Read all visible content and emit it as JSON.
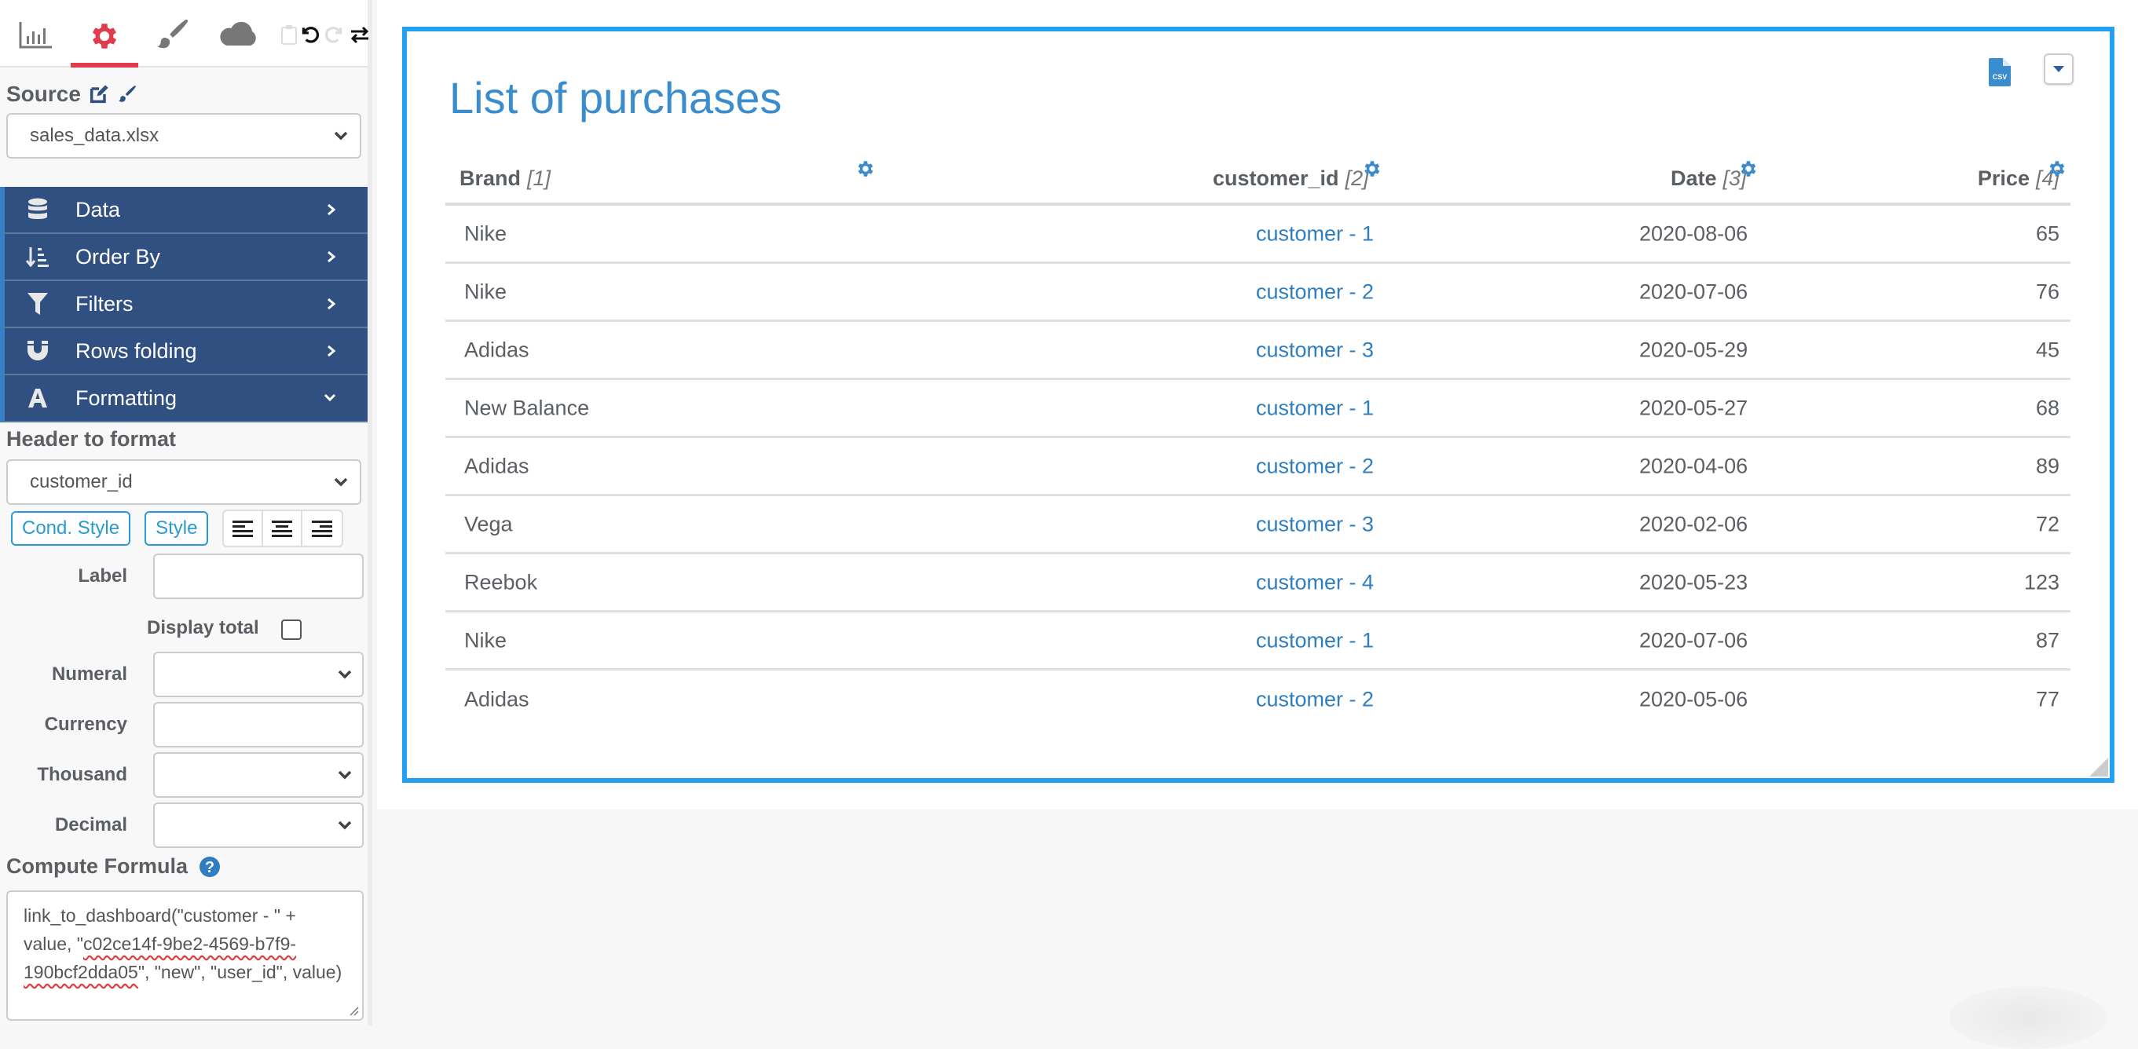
{
  "toolbar": {
    "tabs": [
      {
        "icon": "bar-chart-icon",
        "active": false
      },
      {
        "icon": "gear-icon",
        "active": true
      },
      {
        "icon": "paintbrush-icon",
        "active": false
      },
      {
        "icon": "cloud-icon",
        "active": false
      }
    ],
    "actions": [
      "clipboard-icon",
      "undo-icon",
      "redo-icon",
      "swap-icon"
    ],
    "active_color": "#e23b4d"
  },
  "source": {
    "label": "Source",
    "selected": "sales_data.xlsx"
  },
  "accordion": [
    {
      "label": "Data",
      "icon": "database-icon",
      "expanded": false
    },
    {
      "label": "Order By",
      "icon": "sort-icon",
      "expanded": false
    },
    {
      "label": "Filters",
      "icon": "filter-icon",
      "expanded": false
    },
    {
      "label": "Rows folding",
      "icon": "magnet-icon",
      "expanded": false
    },
    {
      "label": "Formatting",
      "icon": "font-icon",
      "expanded": true
    }
  ],
  "formatting": {
    "header_label": "Header to format",
    "header_selected": "customer_id",
    "cond_style_label": "Cond. Style",
    "style_label": "Style",
    "fields": {
      "label": {
        "label": "Label",
        "value": ""
      },
      "display_total": {
        "label": "Display total",
        "checked": false
      },
      "numeral": {
        "label": "Numeral",
        "value": ""
      },
      "currency": {
        "label": "Currency",
        "value": ""
      },
      "thousand": {
        "label": "Thousand",
        "value": ""
      },
      "decimal": {
        "label": "Decimal",
        "value": ""
      }
    },
    "compute_formula_label": "Compute Formula",
    "formula": {
      "part1": "link_to_dashboard(\"customer - \" + value, \"",
      "part2": "c02ce14f-9be2-4569-b7f9-190bcf2dda05",
      "part3": "\", \"new\", \"user_id\", value)"
    }
  },
  "widget": {
    "title": "List of purchases",
    "border_color": "#23a0f2",
    "columns": [
      {
        "name": "Brand",
        "index": "[1]"
      },
      {
        "name": "customer_id",
        "index": "[2]"
      },
      {
        "name": "Date",
        "index": "[3]"
      },
      {
        "name": "Price",
        "index": "[4]"
      }
    ],
    "rows": [
      {
        "brand": "Nike",
        "customer": "customer - 1",
        "date": "2020-08-06",
        "price": "65"
      },
      {
        "brand": "Nike",
        "customer": "customer - 2",
        "date": "2020-07-06",
        "price": "76"
      },
      {
        "brand": "Adidas",
        "customer": "customer - 3",
        "date": "2020-05-29",
        "price": "45"
      },
      {
        "brand": "New Balance",
        "customer": "customer - 1",
        "date": "2020-05-27",
        "price": "68"
      },
      {
        "brand": "Adidas",
        "customer": "customer - 2",
        "date": "2020-04-06",
        "price": "89"
      },
      {
        "brand": "Vega",
        "customer": "customer - 3",
        "date": "2020-02-06",
        "price": "72"
      },
      {
        "brand": "Reebok",
        "customer": "customer - 4",
        "date": "2020-05-23",
        "price": "123"
      },
      {
        "brand": "Nike",
        "customer": "customer - 1",
        "date": "2020-07-06",
        "price": "87"
      },
      {
        "brand": "Adidas",
        "customer": "customer - 2",
        "date": "2020-05-06",
        "price": "77"
      }
    ]
  }
}
